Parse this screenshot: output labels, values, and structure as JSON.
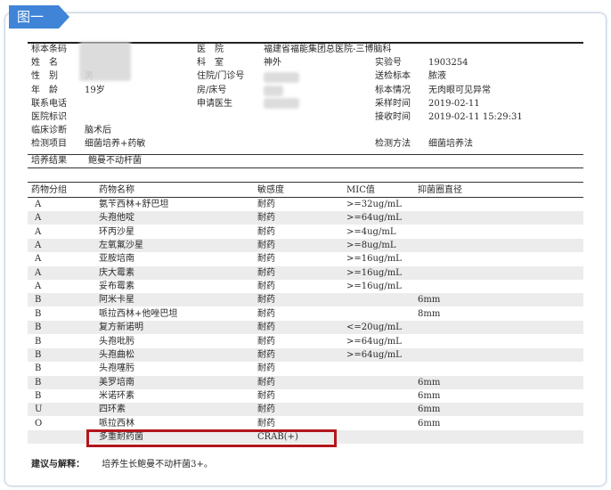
{
  "tag_label": "图一",
  "report": {
    "rows": [
      {
        "label": "标本条码",
        "mid_label": "医　院",
        "mid_value": "福建省福能集团总医院-三博脑科"
      },
      {
        "label": "姓　名",
        "mid_label": "科　室",
        "mid_value": "神外",
        "right_label": "实验号",
        "right_value": "1903254"
      },
      {
        "label": "性　别",
        "value": "男",
        "mid_label": "住院/门诊号",
        "right_label": "送检标本",
        "right_value": "脓液"
      },
      {
        "label": "年　龄",
        "value": "19岁",
        "mid_label": "房/床号",
        "right_label": "标本情况",
        "right_value": "无肉眼可见异常"
      },
      {
        "label": "联系电话",
        "mid_label": "申请医生",
        "right_label": "采样时间",
        "right_value": "2019-02-11"
      },
      {
        "label": "医院标识",
        "right_label": "接收时间",
        "right_value": "2019-02-11  15:29:31"
      },
      {
        "label": "临床诊断",
        "value": "脑术后"
      },
      {
        "label": "检测项目",
        "value": "细菌培养+药敏",
        "right_label": "检测方法",
        "right_value": "细菌培养法"
      }
    ],
    "culture_label": "培养结果",
    "culture_value": "鲍曼不动杆菌"
  },
  "table": {
    "headers": [
      "药物分组",
      "药物名称",
      "敏感度",
      "MIC值",
      "抑菌圈直径"
    ],
    "rows": [
      [
        "A",
        "氨苄西林+舒巴坦",
        "耐药",
        ">=32ug/mL",
        ""
      ],
      [
        "A",
        "头孢他啶",
        "耐药",
        ">=64ug/mL",
        ""
      ],
      [
        "A",
        "环丙沙星",
        "耐药",
        ">=4ug/mL",
        ""
      ],
      [
        "A",
        "左氧氟沙星",
        "耐药",
        ">=8ug/mL",
        ""
      ],
      [
        "A",
        "亚胺培南",
        "耐药",
        ">=16ug/mL",
        ""
      ],
      [
        "A",
        "庆大霉素",
        "耐药",
        ">=16ug/mL",
        ""
      ],
      [
        "A",
        "妥布霉素",
        "耐药",
        ">=16ug/mL",
        ""
      ],
      [
        "B",
        "阿米卡星",
        "耐药",
        "",
        "6mm"
      ],
      [
        "B",
        "哌拉西林+他唑巴坦",
        "耐药",
        "",
        "8mm"
      ],
      [
        "B",
        "复方新诺明",
        "耐药",
        "<=20ug/mL",
        ""
      ],
      [
        "B",
        "头孢吡肟",
        "耐药",
        ">=64ug/mL",
        ""
      ],
      [
        "B",
        "头孢曲松",
        "耐药",
        ">=64ug/mL",
        ""
      ],
      [
        "B",
        "头孢噻肟",
        "耐药",
        "",
        ""
      ],
      [
        "B",
        "美罗培南",
        "耐药",
        "",
        "6mm"
      ],
      [
        "B",
        "米诺环素",
        "耐药",
        "",
        "6mm"
      ],
      [
        "U",
        "四环素",
        "耐药",
        "",
        "6mm"
      ],
      [
        "O",
        "哌拉西林",
        "耐药",
        "",
        "6mm"
      ],
      [
        "",
        "多重耐药菌",
        "CRAB(+)",
        "",
        ""
      ]
    ]
  },
  "footer": {
    "label": "建议与解释：",
    "text": "培养生长鲍曼不动杆菌3+。"
  }
}
